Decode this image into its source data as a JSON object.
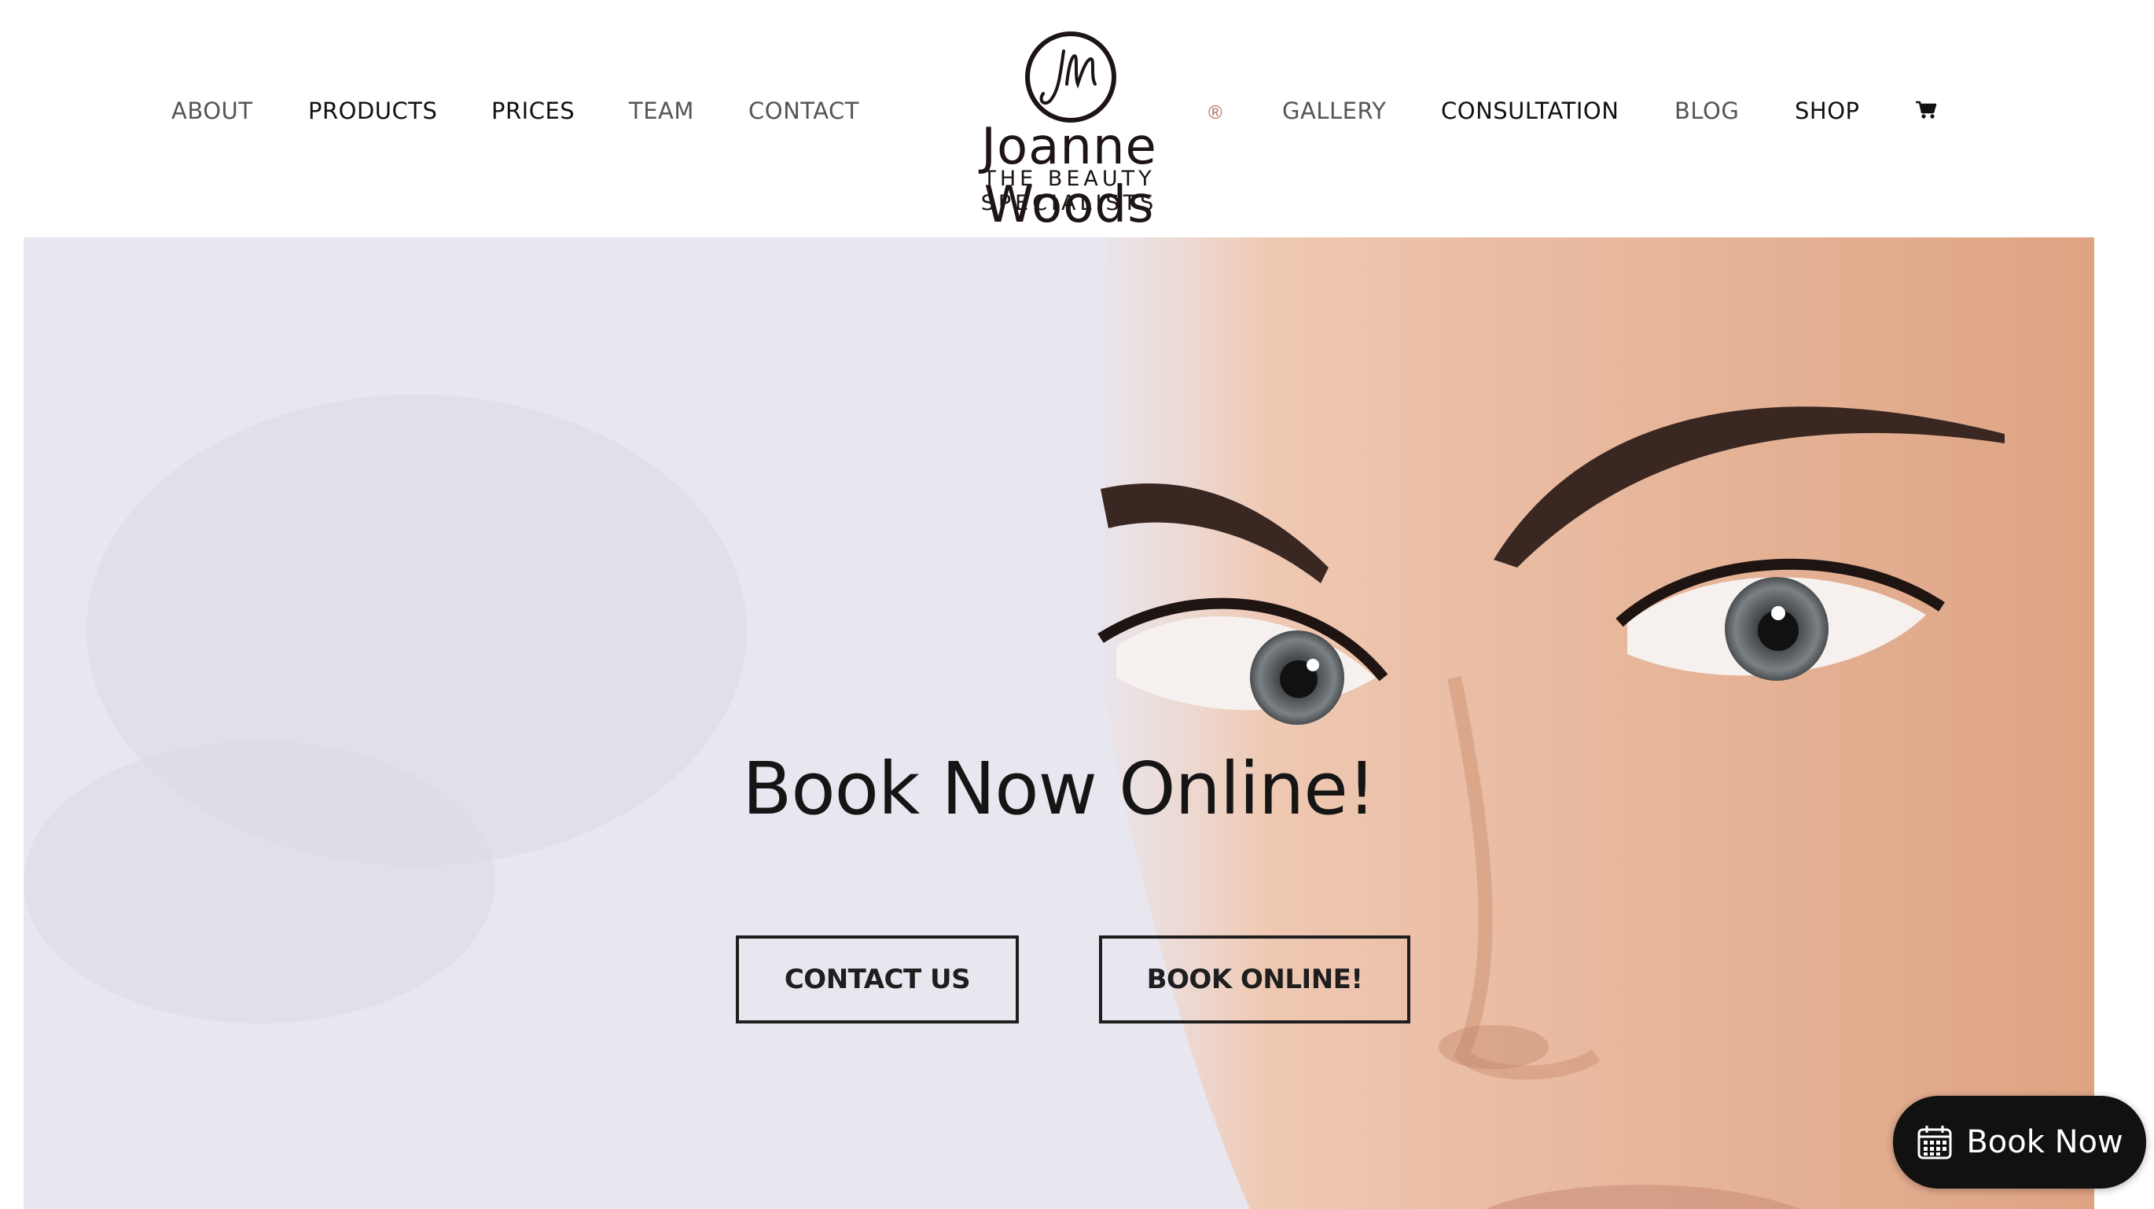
{
  "nav": {
    "left": [
      {
        "label": "ABOUT",
        "style": "light"
      },
      {
        "label": "PRODUCTS",
        "style": "dark"
      },
      {
        "label": "PRICES",
        "style": "dark"
      },
      {
        "label": "TEAM",
        "style": "light"
      },
      {
        "label": "CONTACT",
        "style": "light"
      }
    ],
    "right": [
      {
        "label": "GALLERY",
        "style": "light"
      },
      {
        "label": "CONSULTATION",
        "style": "dark"
      },
      {
        "label": "BLOG",
        "style": "light"
      },
      {
        "label": "SHOP",
        "style": "dark"
      }
    ],
    "cart_icon": "shopping-cart-icon"
  },
  "logo": {
    "monogram": "JW",
    "name": "Joanne Woods",
    "tagline": "THE BEAUTY SPECIALISTS",
    "registered": "®"
  },
  "hero": {
    "title": "Book Now Online!",
    "buttons": {
      "contact": "CONTACT US",
      "book": "BOOK ONLINE!"
    }
  },
  "floating_button": {
    "label": "Book Now",
    "icon": "calendar-icon"
  },
  "colors": {
    "text_dark": "#111111",
    "text_light": "#555555",
    "accent_reg": "#b06a47",
    "hero_bg": "#e8e6ef",
    "skin": "#e9b699"
  }
}
